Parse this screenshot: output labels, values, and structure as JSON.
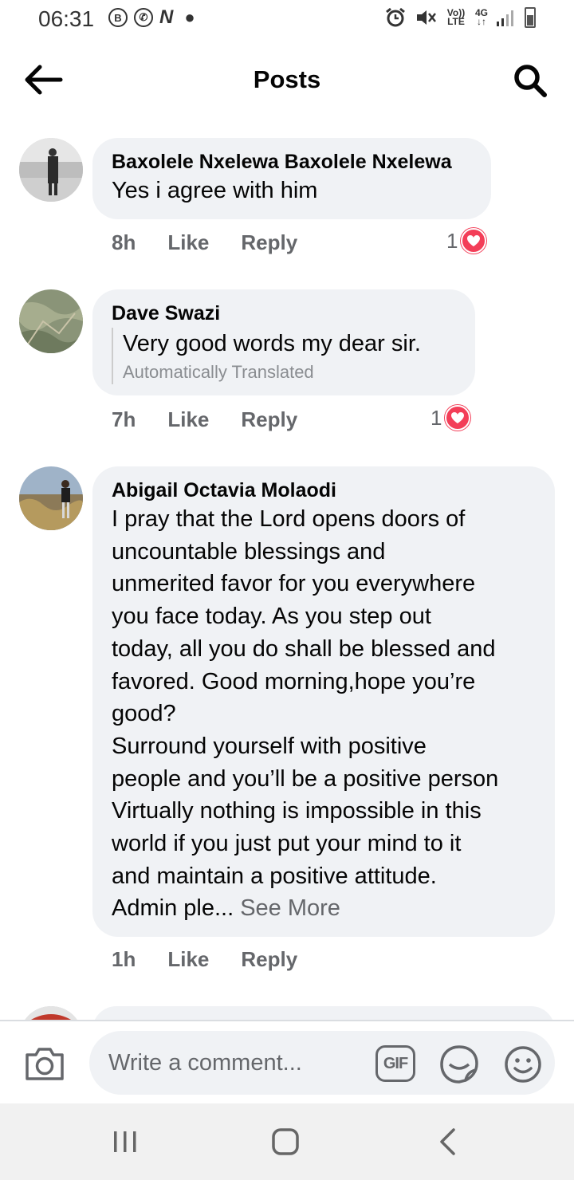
{
  "status_bar": {
    "time": "06:31",
    "network": "4G",
    "volte": "Vo)) LTE"
  },
  "header": {
    "title": "Posts"
  },
  "comments": [
    {
      "author": "Baxolele Nxelewa Baxolele Nxelewa",
      "text": "Yes i agree with him",
      "age": "8h",
      "like_label": "Like",
      "reply_label": "Reply",
      "reaction_count": "1",
      "reaction": "heart-icon"
    },
    {
      "author": "Dave Swazi",
      "text": "Very good words my dear sir.",
      "translation_note": "Automatically Translated",
      "age": "7h",
      "like_label": "Like",
      "reply_label": "Reply",
      "reaction_count": "1",
      "reaction": "heart-icon"
    },
    {
      "author": "Abigail Octavia Molaodi",
      "text": "I pray that the Lord opens doors of\nuncountable blessings and\nunmerited favor for you everywhere\nyou face today. As you step out\ntoday, all you do shall be blessed and\nfavored. Good morning,hope you’re\ngood?\nSurround yourself with positive\npeople and you’ll be a positive person\nVirtually nothing is impossible in this\nworld if you just put your mind to it\nand maintain a positive attitude.\nAdmin ple...",
      "see_more": "See More",
      "age": "1h",
      "like_label": "Like",
      "reply_label": "Reply"
    }
  ],
  "comment_bar": {
    "placeholder": "Write a comment...",
    "gif_label": "GIF"
  },
  "colors": {
    "bubble": "#f0f2f5",
    "secondary_text": "#65676b",
    "love": "#f33e58"
  }
}
